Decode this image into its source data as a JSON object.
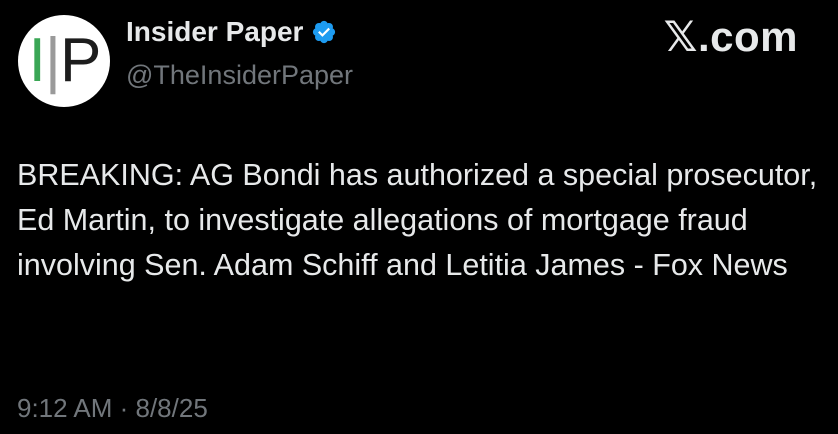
{
  "author": {
    "display_name": "Insider Paper",
    "handle": "@TheInsiderPaper",
    "verified": true,
    "avatar_logo": "IP"
  },
  "brand": "𝕏.com",
  "tweet": {
    "text": "BREAKING: AG Bondi has authorized a special prosecutor, Ed Martin, to investigate allegations of mortgage fraud involving Sen. Adam Schiff and Letitia James - Fox News"
  },
  "timestamp": "9:12 AM · 8/8/25",
  "colors": {
    "background": "#000000",
    "text": "#e7e9ea",
    "muted": "#71767b",
    "verified": "#1d9bf0",
    "logo_green": "#3aa655"
  },
  "icons": {
    "verified": "verified-badge-icon"
  }
}
